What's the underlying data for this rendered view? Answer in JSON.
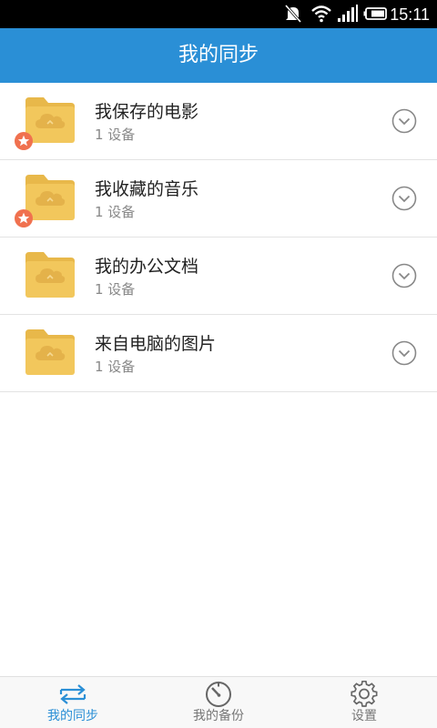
{
  "status_bar": {
    "time": "15:11",
    "icons": [
      "notifications-off-icon",
      "wifi-icon",
      "signal-icon",
      "battery-icon"
    ]
  },
  "app_bar": {
    "title": "我的同步"
  },
  "sync_list": {
    "items": [
      {
        "title": "我保存的电影",
        "subtitle": "1 设备",
        "favorite": true
      },
      {
        "title": "我收藏的音乐",
        "subtitle": "1 设备",
        "favorite": true
      },
      {
        "title": "我的办公文档",
        "subtitle": "1 设备",
        "favorite": false
      },
      {
        "title": "来自电脑的图片",
        "subtitle": "1 设备",
        "favorite": false
      }
    ]
  },
  "bottom_nav": {
    "tabs": [
      {
        "label": "我的同步",
        "icon": "sync-arrows-icon",
        "active": true
      },
      {
        "label": "我的备份",
        "icon": "backup-dial-icon",
        "active": false
      },
      {
        "label": "设置",
        "icon": "gear-icon",
        "active": false
      }
    ]
  },
  "colors": {
    "accent": "#2a8fd6",
    "folder": "#f2c75c",
    "star_badge": "#f0714f",
    "status_bar": "#000000"
  }
}
